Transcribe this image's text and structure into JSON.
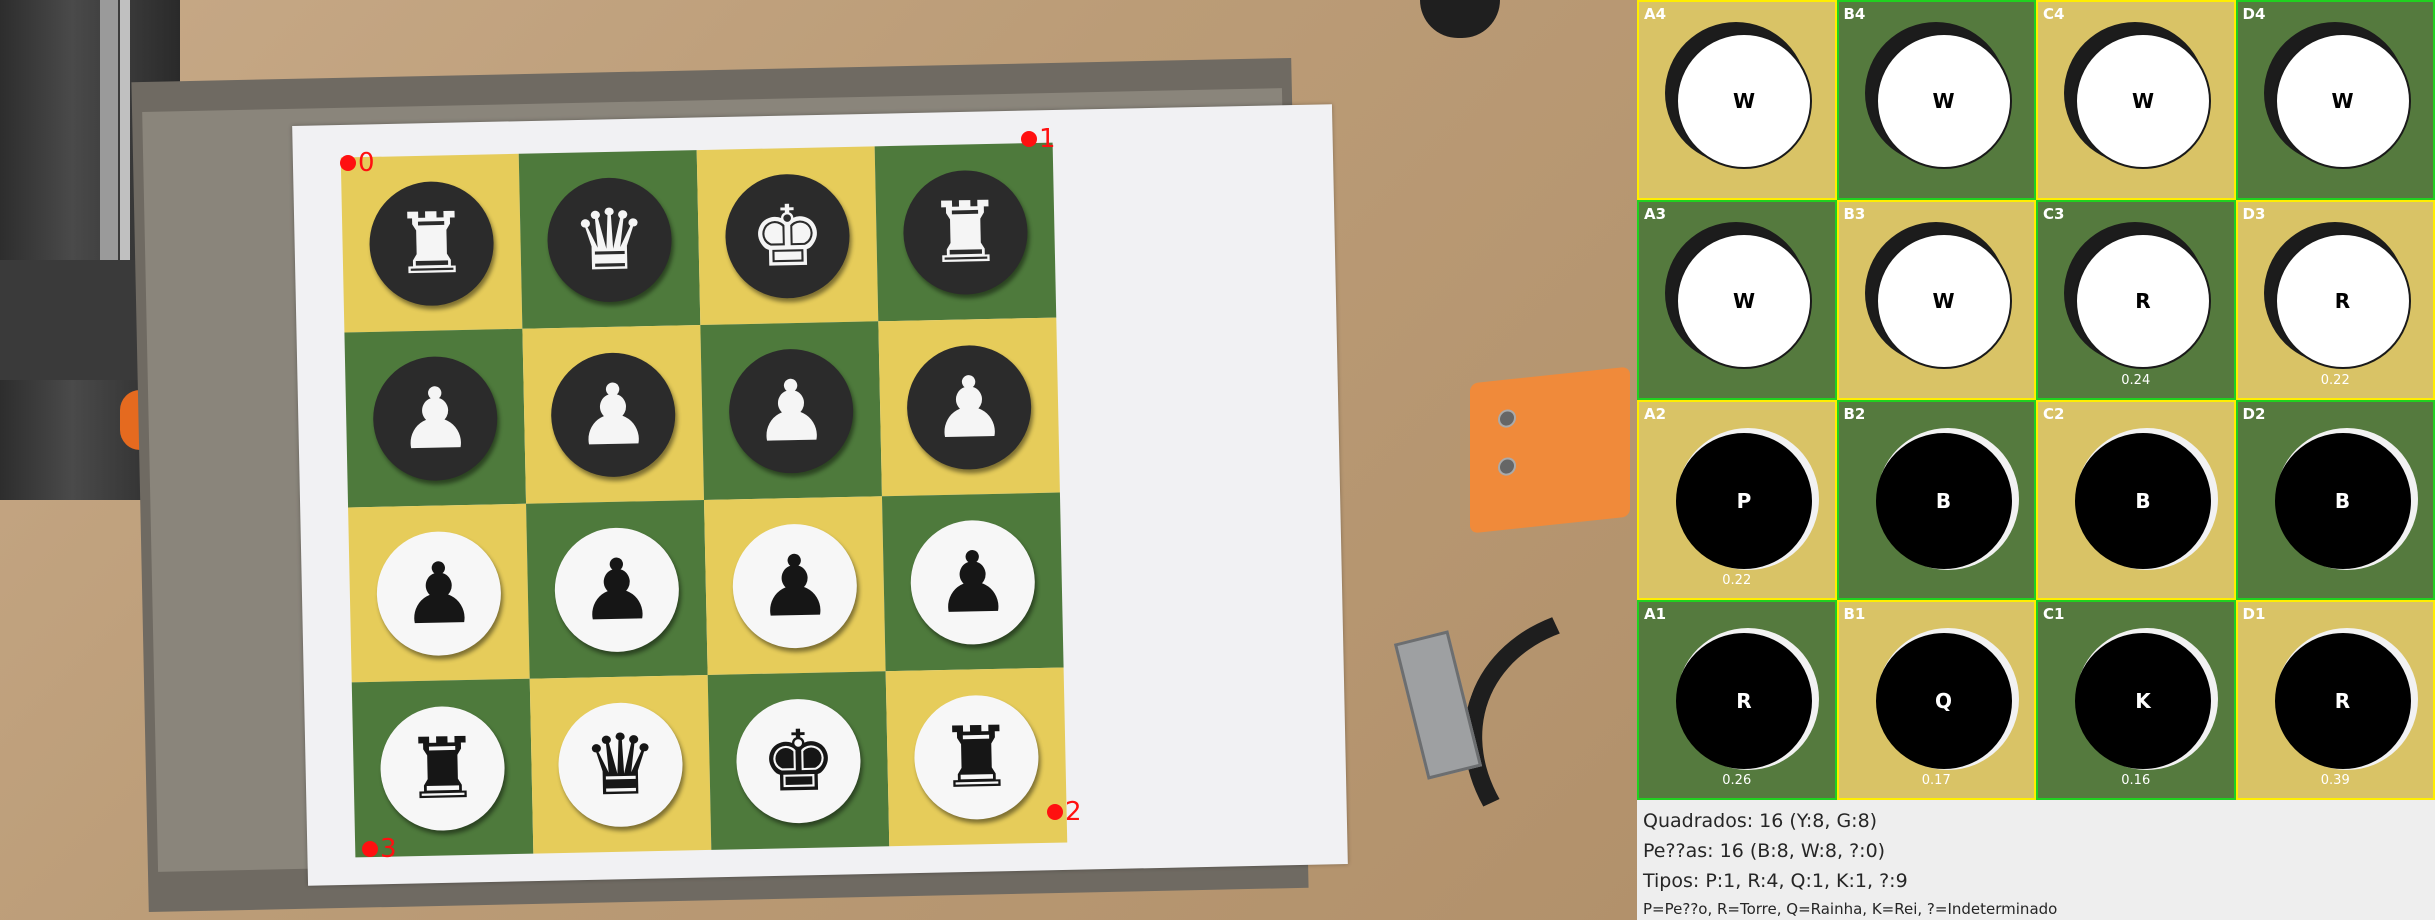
{
  "corner_markers": [
    {
      "label": "0"
    },
    {
      "label": "1"
    },
    {
      "label": "2"
    },
    {
      "label": "3"
    }
  ],
  "physical_board": {
    "rows": [
      [
        {
          "color": "y",
          "piece": "rook",
          "side": "dark",
          "glyph": "♜"
        },
        {
          "color": "g",
          "piece": "queen",
          "side": "dark",
          "glyph": "♛"
        },
        {
          "color": "y",
          "piece": "king",
          "side": "dark",
          "glyph": "♚"
        },
        {
          "color": "g",
          "piece": "rook",
          "side": "dark",
          "glyph": "♜"
        }
      ],
      [
        {
          "color": "g",
          "piece": "pawn",
          "side": "dark",
          "glyph": "♟"
        },
        {
          "color": "y",
          "piece": "pawn",
          "side": "dark",
          "glyph": "♟"
        },
        {
          "color": "g",
          "piece": "pawn",
          "side": "dark",
          "glyph": "♟"
        },
        {
          "color": "y",
          "piece": "pawn",
          "side": "dark",
          "glyph": "♟"
        }
      ],
      [
        {
          "color": "y",
          "piece": "pawn",
          "side": "light",
          "glyph": "♟"
        },
        {
          "color": "g",
          "piece": "pawn",
          "side": "light",
          "glyph": "♟"
        },
        {
          "color": "y",
          "piece": "pawn",
          "side": "light",
          "glyph": "♟"
        },
        {
          "color": "g",
          "piece": "pawn",
          "side": "light",
          "glyph": "♟"
        }
      ],
      [
        {
          "color": "g",
          "piece": "rook",
          "side": "light",
          "glyph": "♜"
        },
        {
          "color": "y",
          "piece": "queen",
          "side": "light",
          "glyph": "♛"
        },
        {
          "color": "g",
          "piece": "king",
          "side": "light",
          "glyph": "♚"
        },
        {
          "color": "y",
          "piece": "rook",
          "side": "light",
          "glyph": "♜"
        }
      ]
    ]
  },
  "debug_grid": {
    "cells": [
      {
        "label": "A4",
        "square": "y",
        "disc": "white",
        "piece_label": "W",
        "confidence": ""
      },
      {
        "label": "B4",
        "square": "g",
        "disc": "white",
        "piece_label": "W",
        "confidence": ""
      },
      {
        "label": "C4",
        "square": "y",
        "disc": "white",
        "piece_label": "W",
        "confidence": ""
      },
      {
        "label": "D4",
        "square": "g",
        "disc": "white",
        "piece_label": "W",
        "confidence": ""
      },
      {
        "label": "A3",
        "square": "g",
        "disc": "white",
        "piece_label": "W",
        "confidence": ""
      },
      {
        "label": "B3",
        "square": "y",
        "disc": "white",
        "piece_label": "W",
        "confidence": ""
      },
      {
        "label": "C3",
        "square": "g",
        "disc": "white",
        "piece_label": "R",
        "confidence": "0.24"
      },
      {
        "label": "D3",
        "square": "y",
        "disc": "white",
        "piece_label": "R",
        "confidence": "0.22"
      },
      {
        "label": "A2",
        "square": "y",
        "disc": "black",
        "piece_label": "P",
        "confidence": "0.22"
      },
      {
        "label": "B2",
        "square": "g",
        "disc": "black",
        "piece_label": "B",
        "confidence": ""
      },
      {
        "label": "C2",
        "square": "y",
        "disc": "black",
        "piece_label": "B",
        "confidence": ""
      },
      {
        "label": "D2",
        "square": "g",
        "disc": "black",
        "piece_label": "B",
        "confidence": ""
      },
      {
        "label": "A1",
        "square": "g",
        "disc": "black",
        "piece_label": "R",
        "confidence": "0.26"
      },
      {
        "label": "B1",
        "square": "y",
        "disc": "black",
        "piece_label": "Q",
        "confidence": "0.17"
      },
      {
        "label": "C1",
        "square": "g",
        "disc": "black",
        "piece_label": "K",
        "confidence": "0.16"
      },
      {
        "label": "D1",
        "square": "y",
        "disc": "black",
        "piece_label": "R",
        "confidence": "0.39"
      }
    ]
  },
  "summary": {
    "squares": "Quadrados: 16 (Y:8, G:8)",
    "pieces": "Pe??as: 16 (B:8, W:8, ?:0)",
    "types": "Tipos: P:1, R:4, Q:1, K:1, ?:9",
    "legend": "P=Pe??o, R=Torre, Q=Rainha, K=Rei, ?=Indeterminado"
  },
  "colors": {
    "yellow_square": "#e6cc5a",
    "green_square": "#4e7a3c",
    "marker_red": "#ff1010",
    "yellow_border": "#ffee00",
    "green_border": "#20d020"
  }
}
